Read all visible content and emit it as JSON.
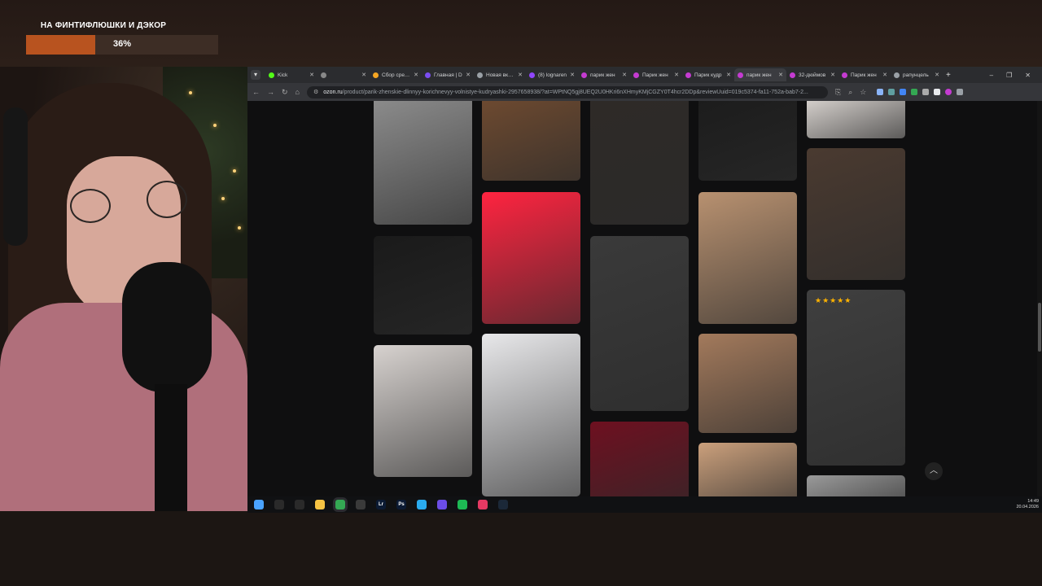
{
  "goal": {
    "title": "НА ФИНТИФЛЮШКИ И ДЭКОР",
    "percent_text": "36%",
    "progress": 0.36
  },
  "browser": {
    "tabs": [
      {
        "label": "Kick",
        "icon": "kick-icon",
        "color": "#53fc18",
        "active": false
      },
      {
        "label": "",
        "icon": "muted-audio-icon",
        "color": "#888888",
        "active": false
      },
      {
        "label": "Сбор средств",
        "icon": "donation-icon",
        "color": "#f5a623",
        "active": false
      },
      {
        "label": "Главная | D",
        "icon": "d-icon",
        "color": "#7a4df0",
        "active": false
      },
      {
        "label": "Новая вкладка",
        "icon": "chrome-icon",
        "color": "#9aa0a6",
        "active": false
      },
      {
        "label": "(8) lognaren",
        "icon": "twitch-icon",
        "color": "#9146ff",
        "active": false
      },
      {
        "label": "парик жен",
        "icon": "ozon-icon",
        "color": "#c43bd1",
        "active": false
      },
      {
        "label": "Парик жен",
        "icon": "ozon-icon",
        "color": "#c43bd1",
        "active": false
      },
      {
        "label": "Парик кудр",
        "icon": "ozon-icon",
        "color": "#c43bd1",
        "active": false
      },
      {
        "label": "парик жен",
        "icon": "ozon-icon",
        "color": "#c43bd1",
        "active": true
      },
      {
        "label": "32-дюймов",
        "icon": "ozon-icon",
        "color": "#c43bd1",
        "active": false
      },
      {
        "label": "Парик жен",
        "icon": "ozon-icon",
        "color": "#c43bd1",
        "active": false
      },
      {
        "label": "рапунцель",
        "icon": "globe-icon",
        "color": "#9aa0a6",
        "active": false
      }
    ],
    "new_tab": "+",
    "window_controls": [
      "–",
      "❐",
      "✕"
    ],
    "url_host": "ozon.ru",
    "url_path": "/product/parik-zhenskie-dlinnyy-korichnevyy-volnistye-kudryashki-2957658938/?at=WPtNQ5gj8UEQ2U0HKri6nXHmyKMjCGZY0T4hcr2DDp&reviewUuid=019c5374-fa11-752a-bab7-2..."
  },
  "gallery": {
    "rating_stars": "★★★★★",
    "images": [
      {
        "c": "#8c8c8c"
      },
      {
        "c": "#1a1a1a"
      },
      {
        "c": "#d7d2cf"
      },
      {
        "c": "#6e4a30"
      },
      {
        "c": "#ff2440"
      },
      {
        "c": "#e8e8ea"
      },
      {
        "c": "#2e2a27"
      },
      {
        "c": "#3a3a3a"
      },
      {
        "c": "#6e1020"
      },
      {
        "c": "#1c1c1c"
      },
      {
        "c": "#b89170"
      },
      {
        "c": "#a37a5c"
      },
      {
        "c": "#cba07c"
      },
      {
        "c": "#d8d3cf"
      },
      {
        "c": "#4a3a30"
      },
      {
        "c": "#3f3f3f"
      },
      {
        "c": "#9a9a9a"
      }
    ]
  },
  "taskbar": {
    "icons": [
      {
        "name": "start-icon",
        "label": "",
        "color": "#4aa3ff"
      },
      {
        "name": "search-icon",
        "label": "",
        "color": "#2a2a2a"
      },
      {
        "name": "task-view-icon",
        "label": "",
        "color": "#2a2a2a"
      },
      {
        "name": "file-explorer-icon",
        "label": "",
        "color": "#f6c343"
      },
      {
        "name": "chrome-icon",
        "label": "",
        "color": "#34a853"
      },
      {
        "name": "obs-icon",
        "label": "",
        "color": "#3a3a3a"
      },
      {
        "name": "lightroom-icon",
        "label": "Lr",
        "color": "#0b1a33"
      },
      {
        "name": "photoshop-icon",
        "label": "Ps",
        "color": "#0b1a33"
      },
      {
        "name": "telegram-icon",
        "label": "",
        "color": "#2aabee"
      },
      {
        "name": "app-grid-icon",
        "label": "",
        "color": "#6b4de6"
      },
      {
        "name": "spotify-icon",
        "label": "",
        "color": "#1db954"
      },
      {
        "name": "app-red-icon",
        "label": "",
        "color": "#e53963"
      },
      {
        "name": "steam-icon",
        "label": "",
        "color": "#1b2838"
      }
    ],
    "time": "14:49",
    "date": "20.04.2026"
  }
}
